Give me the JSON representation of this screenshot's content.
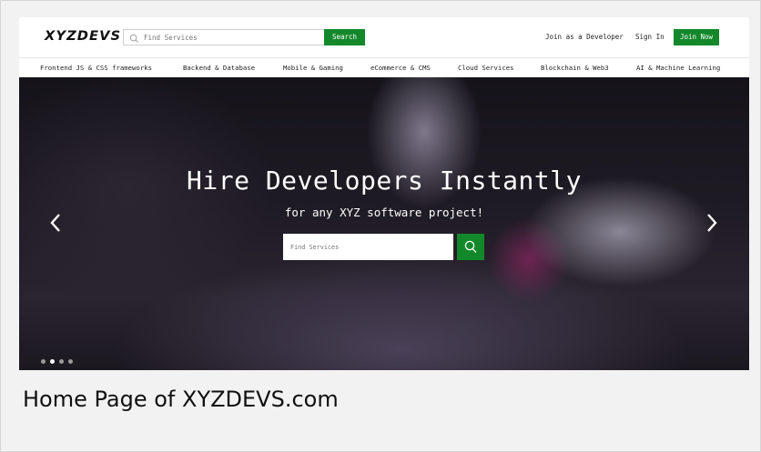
{
  "header": {
    "logo": "XYZDEVS",
    "search_placeholder": "Find Services",
    "search_button": "Search",
    "join_as_developer": "Join as a Developer",
    "sign_in": "Sign In",
    "join_now": "Join Now"
  },
  "categories": [
    "Frontend JS & CSS frameworks",
    "Backend & Database",
    "Mobile & Gaming",
    "eCommerce & CMS",
    "Cloud Services",
    "Blockchain & Web3",
    "AI & Machine Learning"
  ],
  "hero": {
    "title": "Hire Developers Instantly",
    "subtitle": "for any XYZ software project!",
    "search_placeholder": "Find Services",
    "carousel_slides": 4,
    "active_slide": 2
  },
  "caption": "Home Page of XYZDEVS.com",
  "colors": {
    "accent_green": "#13882b",
    "page_background": "#f2f2f2"
  },
  "icons": [
    "search-icon",
    "chevron-left-icon",
    "chevron-right-icon"
  ]
}
